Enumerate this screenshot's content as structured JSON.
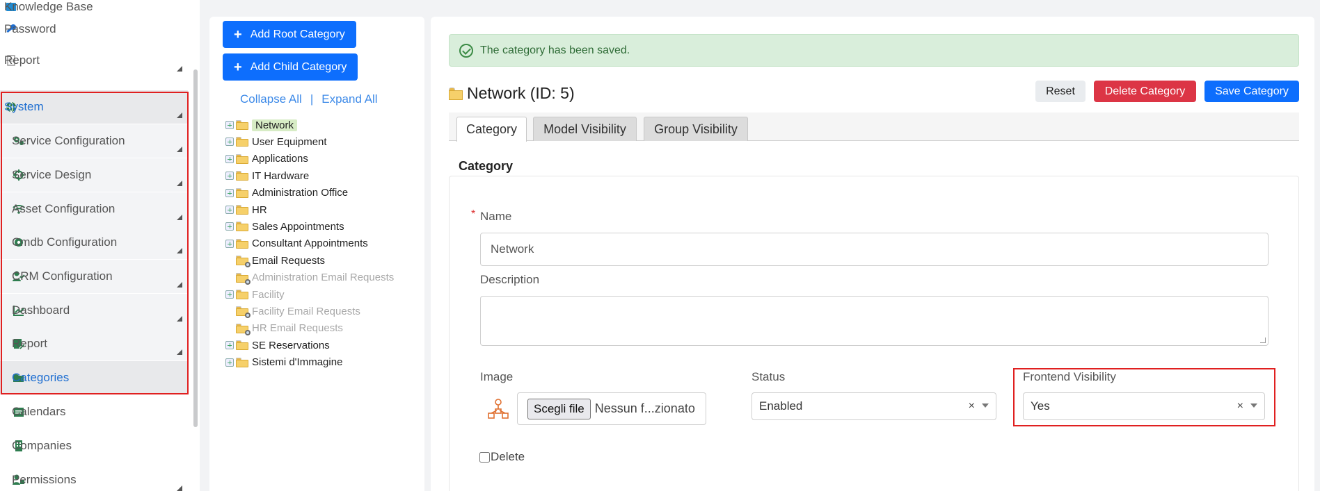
{
  "sidebar": {
    "top_items": [
      {
        "label": "Knowledge Base",
        "icon": "book-icon"
      },
      {
        "label": "Password",
        "icon": "key-icon"
      },
      {
        "label": "Report",
        "icon": "document-icon"
      }
    ],
    "system_label": "System",
    "sub_items": [
      {
        "label": "Service Configuration",
        "icon": "gears-icon"
      },
      {
        "label": "Service Design",
        "icon": "crosshair-icon"
      },
      {
        "label": "Asset Configuration",
        "icon": "wifi-icon"
      },
      {
        "label": "Cmdb Configuration",
        "icon": "gear-icon"
      },
      {
        "label": "CRM Configuration",
        "icon": "user-check-icon"
      },
      {
        "label": "Dashboard",
        "icon": "chart-line-icon"
      },
      {
        "label": "Report",
        "icon": "file-pen-icon"
      },
      {
        "label": "Categories",
        "icon": "folder-open-icon"
      }
    ],
    "bottom_items": [
      {
        "label": "Calendars",
        "icon": "calendar-icon"
      },
      {
        "label": "Companies",
        "icon": "building-icon"
      },
      {
        "label": "Permissions",
        "icon": "user-lock-icon"
      }
    ]
  },
  "tree": {
    "add_root_label": "Add Root Category",
    "add_child_label": "Add Child Category",
    "collapse_all": "Collapse All",
    "separator": "|",
    "expand_all": "Expand All",
    "nodes": [
      {
        "label": "Network",
        "expandable": true,
        "dim": false,
        "selected": true,
        "search": false
      },
      {
        "label": "User Equipment",
        "expandable": true,
        "dim": false,
        "selected": false,
        "search": false
      },
      {
        "label": "Applications",
        "expandable": true,
        "dim": false,
        "selected": false,
        "search": false
      },
      {
        "label": "IT Hardware",
        "expandable": true,
        "dim": false,
        "selected": false,
        "search": false
      },
      {
        "label": "Administration Office",
        "expandable": true,
        "dim": false,
        "selected": false,
        "search": false
      },
      {
        "label": "HR",
        "expandable": true,
        "dim": false,
        "selected": false,
        "search": false
      },
      {
        "label": "Sales Appointments",
        "expandable": true,
        "dim": false,
        "selected": false,
        "search": false
      },
      {
        "label": "Consultant Appointments",
        "expandable": true,
        "dim": false,
        "selected": false,
        "search": false
      },
      {
        "label": "Email Requests",
        "expandable": false,
        "dim": false,
        "selected": false,
        "search": true
      },
      {
        "label": "Administration Email Requests",
        "expandable": false,
        "dim": true,
        "selected": false,
        "search": true
      },
      {
        "label": "Facility",
        "expandable": true,
        "dim": true,
        "selected": false,
        "search": false
      },
      {
        "label": "Facility Email Requests",
        "expandable": false,
        "dim": true,
        "selected": false,
        "search": true
      },
      {
        "label": "HR Email Requests",
        "expandable": false,
        "dim": true,
        "selected": false,
        "search": true
      },
      {
        "label": "SE Reservations",
        "expandable": true,
        "dim": false,
        "selected": false,
        "search": false
      },
      {
        "label": "Sistemi d'Immagine",
        "expandable": true,
        "dim": false,
        "selected": false,
        "search": false
      }
    ]
  },
  "main": {
    "alert": "The category has been saved.",
    "title": "Network (ID: 5)",
    "reset_label": "Reset",
    "delete_label": "Delete Category",
    "save_label": "Save Category",
    "tabs": [
      "Category",
      "Model Visibility",
      "Group Visibility"
    ],
    "section_title": "Category",
    "form": {
      "required_mark": "*",
      "name_label": "Name",
      "name_value": "Network",
      "description_label": "Description",
      "description_value": "",
      "image_label": "Image",
      "file_button": "Scegli file",
      "file_text": "Nessun f...zionato",
      "status_label": "Status",
      "status_value": "Enabled",
      "frontend_label": "Frontend Visibility",
      "frontend_value": "Yes",
      "clear_glyph": "×",
      "delete_label": "Delete"
    }
  },
  "colors": {
    "primary": "#0d6efd",
    "danger": "#dc3545",
    "success_bg": "#d9eedb",
    "sidebar_icon": "#2e7d4f",
    "highlight_box": "#e02020",
    "link": "#1f6fd1"
  }
}
